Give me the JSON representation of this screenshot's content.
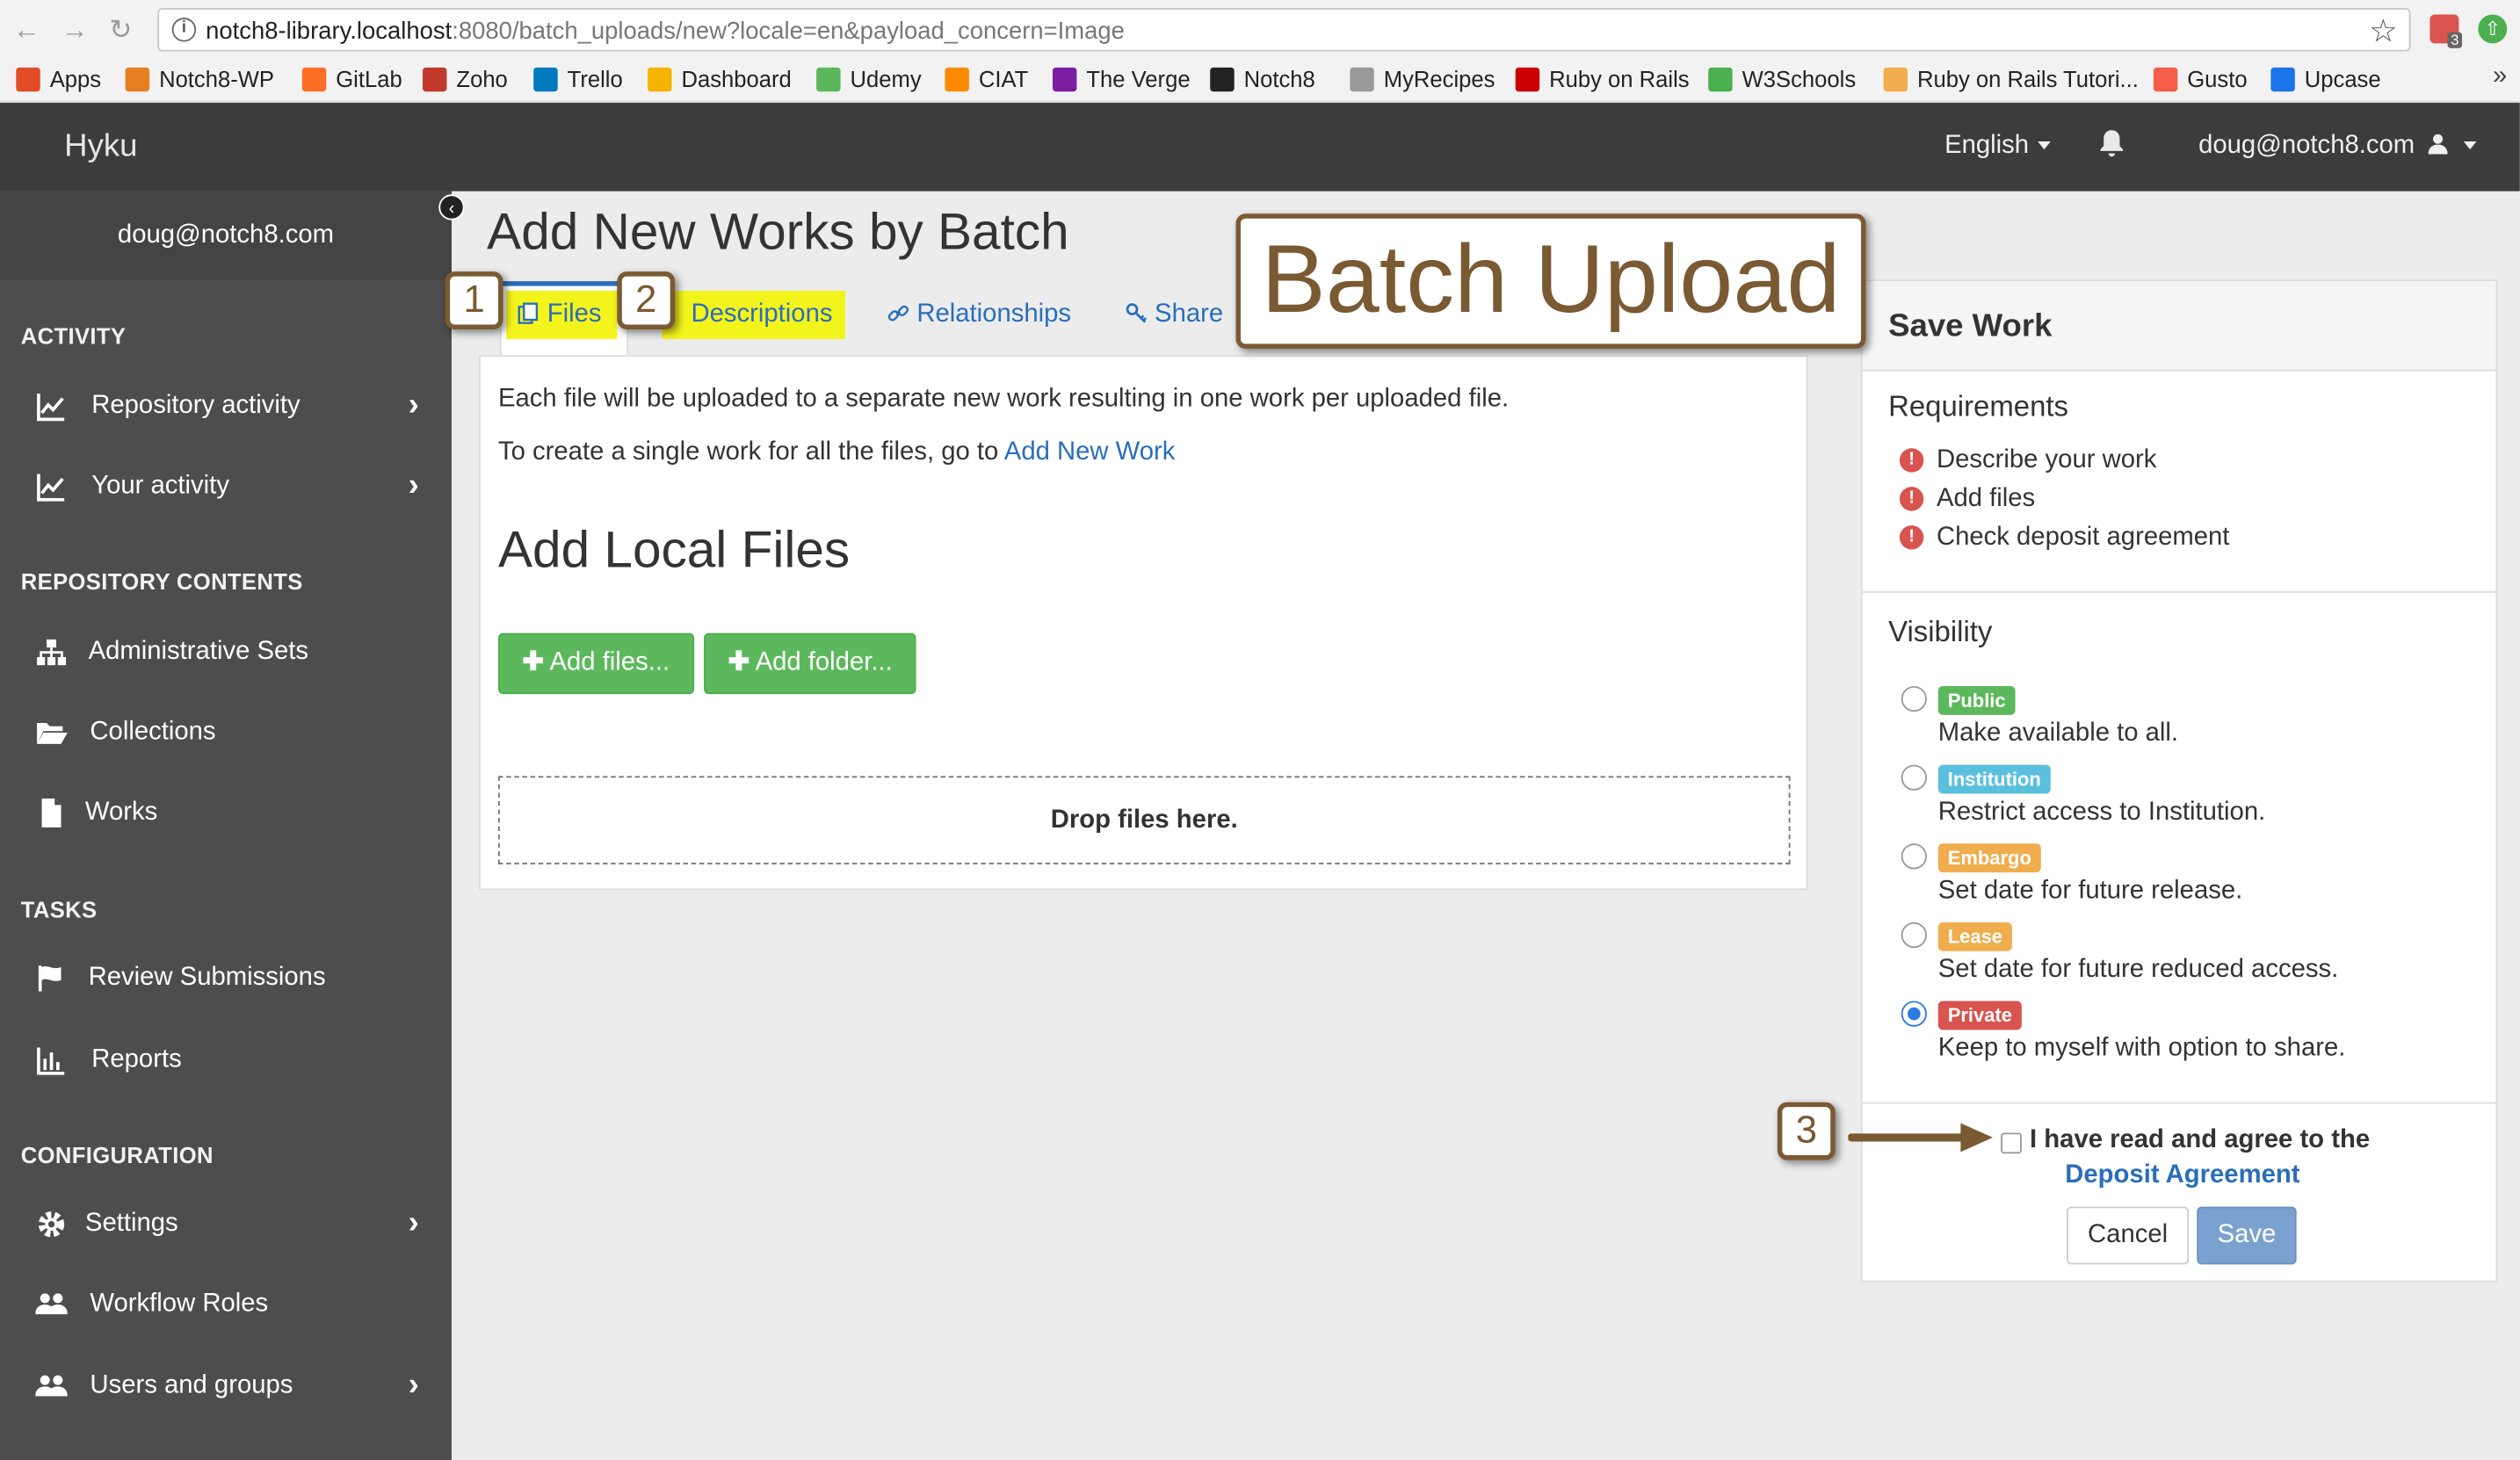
{
  "browser": {
    "url_host": "notch8-library.localhost",
    "url_rest": ":8080/batch_uploads/new?locale=en&payload_concern=Image",
    "ext_badge": "3",
    "bookmarks": [
      {
        "label": "Apps",
        "color": "#e34c26",
        "icon": "apps-grid-icon"
      },
      {
        "label": "Notch8-WP",
        "color": "#e67e22",
        "icon": "notch8-wp-icon"
      },
      {
        "label": "GitLab",
        "color": "#fc6d26",
        "icon": "gitlab-icon"
      },
      {
        "label": "Zoho",
        "color": "#c0392b",
        "icon": "zoho-icon"
      },
      {
        "label": "Trello",
        "color": "#0079bf",
        "icon": "trello-icon"
      },
      {
        "label": "Dashboard",
        "color": "#f4b400",
        "icon": "dashboard-icon"
      },
      {
        "label": "Udemy",
        "color": "#5cb85c",
        "icon": "udemy-icon"
      },
      {
        "label": "CIAT",
        "color": "#ff8a00",
        "icon": "ciat-icon"
      },
      {
        "label": "The Verge",
        "color": "#7b1fa2",
        "icon": "the-verge-icon"
      },
      {
        "label": "Notch8",
        "color": "#222222",
        "icon": "github-icon"
      },
      {
        "label": "MyRecipes",
        "color": "#999999",
        "icon": "page-icon"
      },
      {
        "label": "Ruby on Rails",
        "color": "#cc0000",
        "icon": "rails-icon"
      },
      {
        "label": "W3Schools",
        "color": "#4caf50",
        "icon": "w3schools-icon"
      },
      {
        "label": "Ruby on Rails Tutori...",
        "color": "#f0ad4e",
        "icon": "rails-tutorial-icon"
      },
      {
        "label": "Gusto",
        "color": "#f45d48",
        "icon": "gusto-icon"
      },
      {
        "label": "Upcase",
        "color": "#1a73e8",
        "icon": "upcase-icon"
      }
    ]
  },
  "header": {
    "brand": "Hyku",
    "language": "English",
    "user": "doug@notch8.com"
  },
  "sidebar": {
    "user": "doug@notch8.com",
    "sections": {
      "activity": "ACTIVITY",
      "repository_contents": "REPOSITORY CONTENTS",
      "tasks": "TASKS",
      "configuration": "CONFIGURATION"
    },
    "items": [
      {
        "label": "Repository activity",
        "icon": "chart-line-icon"
      },
      {
        "label": "Your activity",
        "icon": "chart-line-icon"
      },
      {
        "label": "Administrative Sets",
        "icon": "sitemap-icon"
      },
      {
        "label": "Collections",
        "icon": "folder-open-icon"
      },
      {
        "label": "Works",
        "icon": "file-icon"
      },
      {
        "label": "Review Submissions",
        "icon": "flag-icon"
      },
      {
        "label": "Reports",
        "icon": "bar-chart-icon"
      },
      {
        "label": "Settings",
        "icon": "gear-icon"
      },
      {
        "label": "Workflow Roles",
        "icon": "users-icon"
      },
      {
        "label": "Users and groups",
        "icon": "users-icon"
      }
    ]
  },
  "main": {
    "title": "Add New Works by Batch",
    "tabs": [
      "Files",
      "Descriptions",
      "Relationships",
      "Share"
    ],
    "intro_line1": "Each file will be uploaded to a separate new work resulting in one work per uploaded file.",
    "intro_line2_prefix": "To create a single work for all the files, go to",
    "intro_line2_link": "Add New Work",
    "local_heading": "Add Local Files",
    "add_files_btn": "Add files...",
    "add_folder_btn": "Add folder...",
    "drop_text": "Drop files here."
  },
  "save_work": {
    "title": "Save Work",
    "requirements_heading": "Requirements",
    "requirements": [
      "Describe your work",
      "Add files",
      "Check deposit agreement"
    ],
    "visibility_heading": "Visibility",
    "visibility_options": [
      {
        "badge": "Public",
        "desc": "Make available to all.",
        "color": "#5cb85c",
        "selected": false
      },
      {
        "badge": "Institution",
        "desc": "Restrict access to Institution.",
        "color": "#5bc0de",
        "selected": false
      },
      {
        "badge": "Embargo",
        "desc": "Set date for future release.",
        "color": "#f0ad4e",
        "selected": false
      },
      {
        "badge": "Lease",
        "desc": "Set date for future reduced access.",
        "color": "#f0ad4e",
        "selected": false
      },
      {
        "badge": "Private",
        "desc": "Keep to myself with option to share.",
        "color": "#d9534f",
        "selected": true
      }
    ],
    "agreement_text": "I have read and agree to the",
    "agreement_link": "Deposit Agreement",
    "cancel": "Cancel",
    "save": "Save"
  },
  "annotations": {
    "step1": "1",
    "step2": "2",
    "step3": "3",
    "callout": "Batch Upload"
  }
}
